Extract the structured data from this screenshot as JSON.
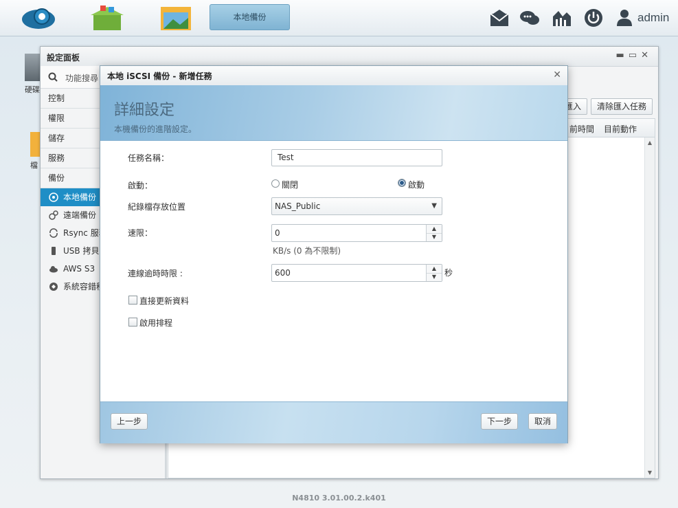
{
  "taskbar": {
    "window_button": "本地備份",
    "user": "admin"
  },
  "desktop": {
    "icon1_label": "硬碟",
    "icon2_label": "檔",
    "version": "N4810   3.01.00.2.k401"
  },
  "panel": {
    "title": "設定面板",
    "search_placeholder": "功能搜尋",
    "categories": [
      "控制",
      "權限",
      "儲存",
      "服務",
      "備份"
    ],
    "sub_items": [
      "本地備份",
      "遠端備份",
      "Rsync 服務",
      "USB 拷貝",
      "AWS S3",
      "系統容錯移"
    ],
    "buttons": {
      "import": "匯入",
      "clear_import": "清除匯入任務"
    },
    "columns": {
      "time": "前時間",
      "action": "目前動作"
    }
  },
  "dialog": {
    "title": "本地 iSCSI 備份 - 新增任務",
    "heading": "詳細設定",
    "subheading": "本機備份的進階設定。",
    "fields": {
      "task_name_label": "任務名稱：",
      "task_name_value": "Test",
      "enable_label": "啟動：",
      "radio_off": "關閉",
      "radio_on": "啟動",
      "log_location_label": "紀錄檔存放位置",
      "log_location_value": "NAS_Public",
      "speed_label": "速限：",
      "speed_value": "0",
      "speed_hint": "KB/s (0 為不限制)",
      "timeout_label": "連線逾時時限 :",
      "timeout_value": "600",
      "timeout_unit": "秒",
      "direct_update_label": "直接更新資料",
      "schedule_label": "啟用排程"
    },
    "buttons": {
      "prev": "上一步",
      "next": "下一步",
      "cancel": "取消"
    }
  }
}
